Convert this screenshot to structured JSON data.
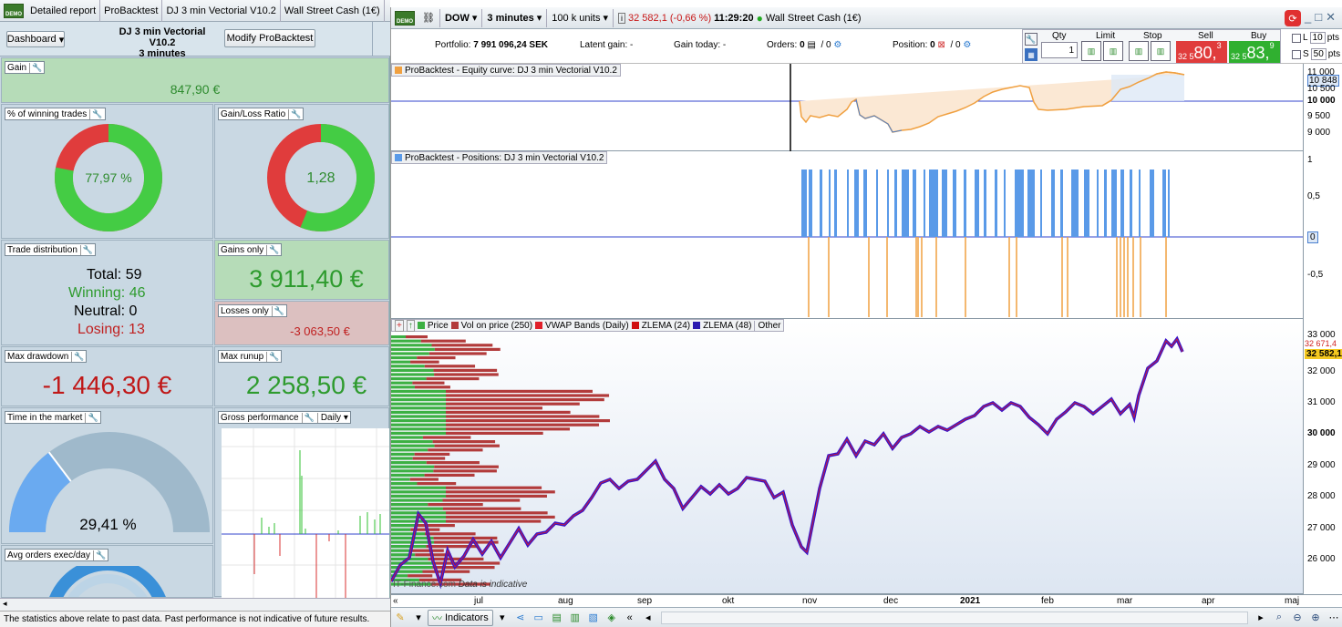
{
  "left": {
    "tabs": [
      "Detailed report",
      "ProBacktest",
      "DJ 3 min Vectorial V10.2",
      "Wall Street Cash (1€)"
    ],
    "demo_label": "DEMO",
    "dashboard_label": "Dashboard",
    "strategy_title": "DJ 3 min Vectorial V10.2",
    "strategy_timeframe": "3 minutes",
    "modify_button": "Modify ProBacktest",
    "gain": {
      "label": "Gain",
      "value": "847,90 €"
    },
    "winning_trades": {
      "label": "% of winning trades",
      "value": "77,97 %",
      "fraction": 0.7797
    },
    "gain_loss_ratio": {
      "label": "Gain/Loss Ratio",
      "value": "1,28",
      "fraction": 0.5614
    },
    "trade_distribution": {
      "label": "Trade distribution",
      "total": "Total: 59",
      "winning": "Winning: 46",
      "neutral": "Neutral: 0",
      "losing": "Losing: 13"
    },
    "gains_only": {
      "label": "Gains only",
      "value": "3 911,40 €"
    },
    "losses_only": {
      "label": "Losses only",
      "value": "-3 063,50 €"
    },
    "max_drawdown": {
      "label": "Max drawdown",
      "value": "-1 446,30 €"
    },
    "max_runup": {
      "label": "Max runup",
      "value": "2 258,50 €"
    },
    "time_in_market": {
      "label": "Time in the market",
      "value": "29,41 %",
      "fraction": 0.2941
    },
    "gross_performance": {
      "label": "Gross performance",
      "period": "Daily"
    },
    "avg_orders": {
      "label": "Avg orders exec/day"
    },
    "footer": "The statistics above relate to past data. Past performance is not indicative of future results."
  },
  "right": {
    "toolbar": {
      "instrument": "DOW",
      "timeframe": "3 minutes",
      "units": "100 k units",
      "price_change": "32 582,1 (-0,66 %)",
      "time": "11:29:20",
      "market": "Wall Street Cash (1€)"
    },
    "quotebar": {
      "portfolio": "Portfolio:",
      "portfolio_value": "7 991 096,24 SEK",
      "latent_gain": "Latent gain: -",
      "gain_today": "Gain today: -",
      "orders": "Orders:",
      "orders_value_a": "0",
      "orders_value_b": "/ 0",
      "position": "Position:",
      "position_value_a": "0",
      "position_value_b": "/ 0",
      "qty_label": "Qty",
      "qty_value": "1",
      "limit_label": "Limit",
      "stop_label": "Stop",
      "sell_label": "Sell",
      "buy_label": "Buy",
      "sell_prefix": "32 5",
      "sell_big": "80,",
      "sell_sup": "3",
      "buy_prefix": "32 5",
      "buy_big": "83,",
      "buy_sup": "9",
      "l_label": "L",
      "l_value": "10",
      "s_label": "S",
      "s_value": "50",
      "pts": "pts"
    },
    "equity": {
      "title": "ProBacktest - Equity curve: DJ 3 min Vectorial V10.2",
      "ticks": [
        "11 000",
        "10 848",
        "10 500",
        "10 000",
        "9 500",
        "9 000"
      ]
    },
    "positions": {
      "title": "ProBacktest - Positions: DJ 3 min Vectorial V10.2",
      "ticks": [
        "1",
        "0,5",
        "0",
        "-0,5"
      ]
    },
    "price": {
      "legend": [
        "Price",
        "Vol on price (250)",
        "VWAP Bands (Daily)",
        "ZLEMA (24)",
        "ZLEMA (48)",
        "Other"
      ],
      "legend_colors": [
        "#3cb043",
        "#b23b3b",
        "#e0202a",
        "#d01010",
        "#2a1ab0",
        "#ffffff"
      ],
      "ticks": [
        "33 000",
        "32 671,4",
        "32 582,1",
        "32 000",
        "31 000",
        "30 000",
        "29 000",
        "28 000",
        "27 000",
        "26 000"
      ],
      "watermark": "IT-Finance.com",
      "indicative": "Data is indicative"
    },
    "xaxis": [
      "jul",
      "aug",
      "sep",
      "okt",
      "nov",
      "dec",
      "2021",
      "feb",
      "mar",
      "apr",
      "maj"
    ],
    "bottombar": {
      "indicators": "Indicators"
    }
  }
}
